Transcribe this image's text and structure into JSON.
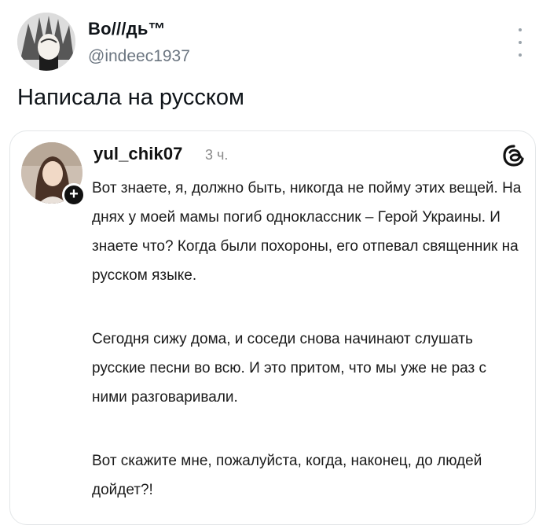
{
  "author": {
    "name": "Bo///дь™",
    "handle": "@indeec1937",
    "avatar_icon": "avatar-portrait-icon"
  },
  "post": {
    "text": "Написала на русском"
  },
  "embed": {
    "username": "yul_chik07",
    "time": "3 ч.",
    "app_icon": "threads-icon",
    "paragraphs": [
      "Вот знаете, я, должно быть, никогда не пойму этих вещей. На днях у моей мамы погиб одноклассник – Герой Украины. И знаете что? Когда были похороны, его отпевал священник на русском языке.",
      "Сегодня сижу дома, и соседи снова начинают слушать русские песни во всю. И это притом, что мы уже не раз с ними разговаривали.",
      "Вот скажите мне, пожалуйста, когда, наконец, до людей дойдет?!"
    ]
  },
  "colors": {
    "text": "#0f1419",
    "muted": "#6b7580",
    "border": "#e3e6e8"
  }
}
